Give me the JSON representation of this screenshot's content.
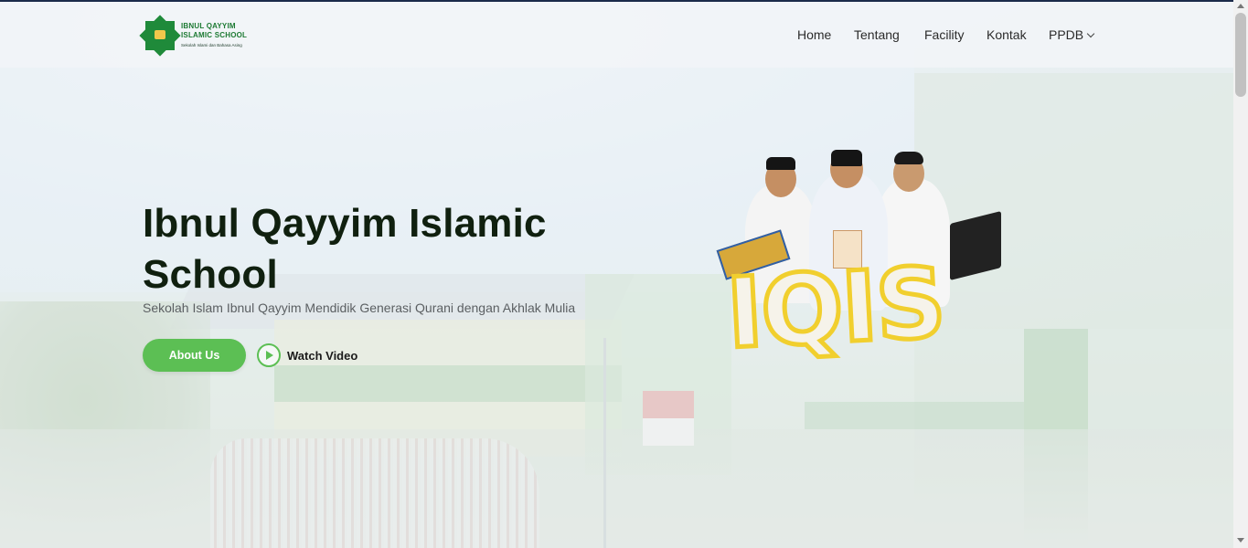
{
  "brand": {
    "logo_line1": "IBNUL QAYYIM",
    "logo_line2": "ISLAMIC SCHOOL",
    "logo_tagline": "Sekolah Islami dan Bahasa Asing"
  },
  "nav": {
    "items": [
      {
        "label": "Home"
      },
      {
        "label": "Tentang"
      },
      {
        "label": "Facility"
      },
      {
        "label": "Kontak"
      },
      {
        "label": "PPDB"
      }
    ]
  },
  "hero": {
    "title": "Ibnul Qayyim Islamic School",
    "subtitle": "Sekolah Islam Ibnul Qayyim Mendidik Generasi Qurani dengan Akhlak Mulia",
    "primary_button": "About Us",
    "video_button": "Watch Video",
    "badge_text": "IQIS"
  },
  "colors": {
    "accent": "#5cbf54",
    "brand_green": "#1f8a3a",
    "badge_outline": "#f1cf2e",
    "title": "#10200f"
  },
  "icons": {
    "play": "play-icon",
    "dropdown": "chevron-down-icon"
  }
}
